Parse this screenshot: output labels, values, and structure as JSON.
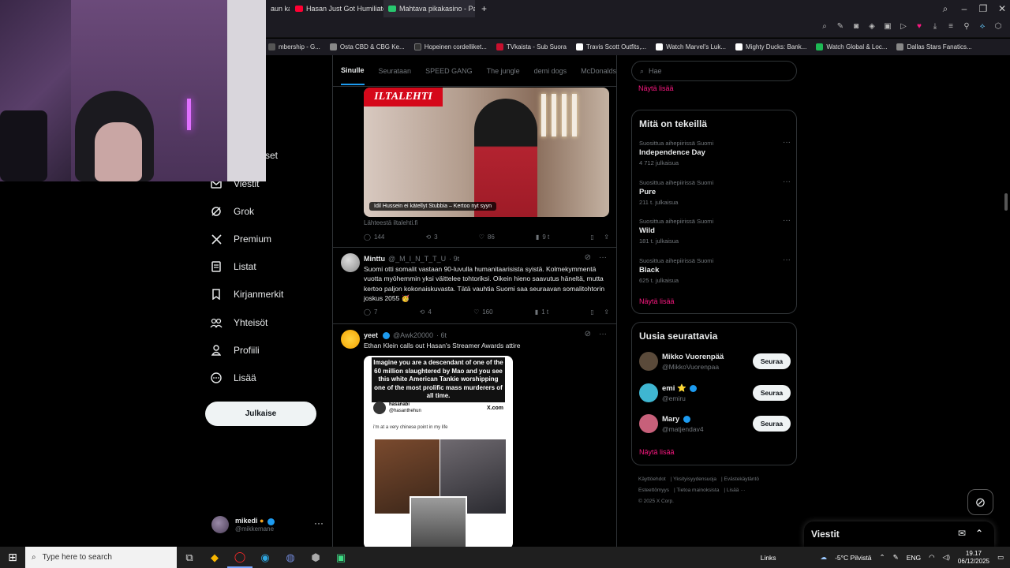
{
  "browser": {
    "tabs": [
      {
        "label": "aun kans",
        "color": "#6b6b6b"
      },
      {
        "label": "Hasan Just Got Humiliate",
        "color": "#ff0033"
      },
      {
        "label": "Mahtava pikakasino - Pari",
        "color": "#28c76f"
      }
    ],
    "new_tab": "+"
  },
  "bookmarks": [
    {
      "label": "mbership - G...",
      "color": "#555"
    },
    {
      "label": "Osta CBD & CBG Ke...",
      "color": "#888"
    },
    {
      "label": "Hopeinen cordelliket...",
      "color": "#333"
    },
    {
      "label": "TVkaista - Sub Suora",
      "color": "#c8102e"
    },
    {
      "label": "Travis Scott Outfits,...",
      "color": "#fff"
    },
    {
      "label": "Watch Marvel's Luk...",
      "color": "#fff"
    },
    {
      "label": "Mighty Ducks: Bank...",
      "color": "#fff"
    },
    {
      "label": "Watch Global & Loc...",
      "color": "#1db954"
    },
    {
      "label": "Dallas Stars Fanatics...",
      "color": "#888"
    }
  ],
  "nav": {
    "partial": "set",
    "items": [
      {
        "label": "Viestit",
        "icon": "mail-icon"
      },
      {
        "label": "Grok",
        "icon": "grok-icon"
      },
      {
        "label": "Premium",
        "icon": "x-logo-icon"
      },
      {
        "label": "Listat",
        "icon": "list-icon"
      },
      {
        "label": "Kirjanmerkit",
        "icon": "bookmark-icon"
      },
      {
        "label": "Yhteisöt",
        "icon": "communities-icon"
      },
      {
        "label": "Profiili",
        "icon": "profile-icon"
      },
      {
        "label": "Lisää",
        "icon": "more-circle-icon"
      }
    ],
    "post_button": "Julkaise",
    "account": {
      "name": "mikedi",
      "handle": "@mikkemane",
      "more": "···"
    }
  },
  "feed": {
    "tabs": [
      "Sinulle",
      "Seurataan",
      "SPEED GANG",
      "The jungle",
      "demi dogs",
      "McDonalds"
    ],
    "media_tweet": {
      "logo": "ILTALEHTI",
      "caption": "Idil Hussein ei kätellyt Stubbia – Kertoo nyt syyn",
      "source": "Lähteestä iltalehti.fi",
      "replies": "144",
      "reposts": "3",
      "likes": "86",
      "views": "9 t"
    },
    "tweet2": {
      "name": "Minttu",
      "handle": "@_M_I_N_T_T_U",
      "time": "· 9t",
      "text": "Suomi otti somalit vastaan 90-luvulla humanitaarisista syistä. Kolmekymmentä vuotta myöhemmin yksi väittelee tohtoriksi. Oikein hieno saavutus häneltä, mutta kertoo paljon kokonaiskuvasta. Tätä vauhtia Suomi saa seuraavan somalitohtorin joskus 2055 🥳",
      "replies": "7",
      "reposts": "4",
      "likes": "160",
      "views": "1 t"
    },
    "tweet3": {
      "name": "yeet",
      "handle": "@Awk20000",
      "time": "· 6t",
      "text": "Ethan Klein calls out Hasan's Streamer Awards attire",
      "image_caption": "Imagine you are a descendant of one of the 60 million slaughtered by Mao and you see this white American Tankie worshipping one of the most prolific mass murderers of all time.",
      "embed_name": "hasanabi",
      "embed_handle": "@hasanthehun",
      "embed_site": "X.com",
      "embed_text": "i'm at a very chinese point in my life"
    }
  },
  "sidebar": {
    "search_placeholder": "Hae",
    "top_show_more": "Näytä lisää",
    "trends_title": "Mitä on tekeillä",
    "trends": [
      {
        "context": "Suosittua aihepiirissä Suomi",
        "name": "Independence Day",
        "count": "4 712 julkaisua"
      },
      {
        "context": "Suosittua aihepiirissä Suomi",
        "name": "Pure",
        "count": "211 t. julkaisua"
      },
      {
        "context": "Suosittua aihepiirissä Suomi",
        "name": "Wild",
        "count": "181 t. julkaisua"
      },
      {
        "context": "Suosittua aihepiirissä Suomi",
        "name": "Black",
        "count": "625 t. julkaisua"
      }
    ],
    "trends_show_more": "Näytä lisää",
    "follow_title": "Uusia seurattavia",
    "follows": [
      {
        "name": "Mikko Vuorenpää",
        "handle": "@MikkoVuorenpaa",
        "button": "Seuraa",
        "color": "#5a4a3a"
      },
      {
        "name": "emi ⭐",
        "handle": "@emiru",
        "button": "Seuraa",
        "color": "#3fb6d1"
      },
      {
        "name": "Mary",
        "handle": "@matjendav4",
        "button": "Seuraa",
        "color": "#c7607a"
      }
    ],
    "follow_show_more": "Näytä lisää",
    "footer": [
      "Käyttöehdot",
      "Yksityisyydensuoja",
      "Evästekäytäntö",
      "Esteettömyys",
      "Tietoa mainoksista",
      "Lisää ···",
      "© 2025 X Corp."
    ]
  },
  "messages_drawer": {
    "title": "Viestit"
  },
  "taskbar": {
    "search_placeholder": "Type here to search",
    "links": "Links",
    "weather": "-5°C  Pilvistä",
    "lang": "ENG",
    "time": "19.17",
    "date": "06/12/2025"
  },
  "colors": {
    "accent_pink": "#f91880",
    "blue": "#1d9bf0",
    "border": "#2f3336"
  }
}
